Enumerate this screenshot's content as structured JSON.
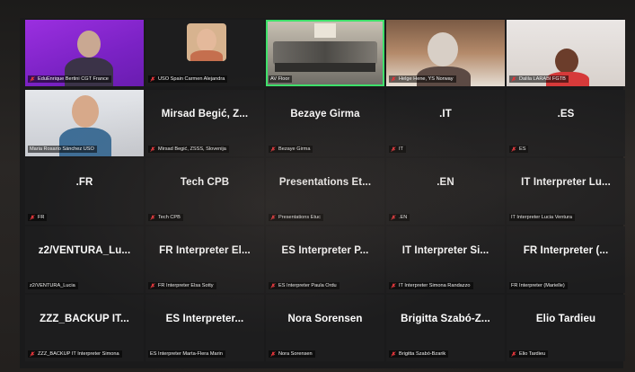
{
  "colors": {
    "background": "#1a1a1b",
    "active_speaker_border": "#3ee06a",
    "mic_muted": "#e0353a",
    "text": "#ffffff"
  },
  "participants": [
    {
      "label": "EduEnrique Bertini CGT France",
      "display_name": "",
      "video": true,
      "muted": true,
      "top_text": ""
    },
    {
      "label": "USO Spain Carmen Alejandra",
      "display_name": "",
      "video": true,
      "muted": true
    },
    {
      "label": "AV Floor",
      "display_name": "",
      "video": true,
      "muted": false,
      "active": true
    },
    {
      "label": "Helge Hene, YS Norway",
      "display_name": "",
      "video": true,
      "muted": true
    },
    {
      "label": "Dalila LARABI FGTB",
      "display_name": "",
      "video": true,
      "muted": true
    },
    {
      "label": "Maria Rosario Sánchez USO",
      "display_name": "",
      "video": true,
      "muted": false
    },
    {
      "label": "Mirsad Begić, ZSSS, Slovenija",
      "display_name": "Mirsad Begić, Z...",
      "video": false,
      "muted": true
    },
    {
      "label": "Bezaye Girma",
      "display_name": "Bezaye Girma",
      "video": false,
      "muted": true
    },
    {
      "label": "IT",
      "display_name": ".IT",
      "video": false,
      "muted": true
    },
    {
      "label": "ES",
      "display_name": ".ES",
      "video": false,
      "muted": true
    },
    {
      "label": "FR",
      "display_name": ".FR",
      "video": false,
      "muted": true
    },
    {
      "label": "Tech CPB",
      "display_name": "Tech CPB",
      "video": false,
      "muted": true
    },
    {
      "label": "Presentations Etuc",
      "display_name": "Presentations Et...",
      "video": false,
      "muted": true
    },
    {
      "label": ".EN",
      "display_name": ".EN",
      "video": false,
      "muted": true
    },
    {
      "label": "IT Interpreter Lucia Ventura",
      "display_name": "IT Interpreter Lu...",
      "video": false,
      "muted": false
    },
    {
      "label": "z2/VENTURA_Lucia",
      "display_name": "z2/VENTURA_Lu...",
      "video": false,
      "muted": false
    },
    {
      "label": "FR Interpreter Elsa Sotty",
      "display_name": "FR Interpreter El...",
      "video": false,
      "muted": true
    },
    {
      "label": "ES Interpreter Paula Ordu",
      "display_name": "ES Interpreter P...",
      "video": false,
      "muted": true
    },
    {
      "label": "IT Interpreter Simona Randazzo",
      "display_name": "IT Interpreter Si...",
      "video": false,
      "muted": true
    },
    {
      "label": "FR Interpreter (Marielle)",
      "display_name": "FR Interpreter (...",
      "video": false,
      "muted": false
    },
    {
      "label": "ZZZ_BACKUP IT Interpreter Simona",
      "display_name": "ZZZ_BACKUP IT...",
      "video": false,
      "muted": true
    },
    {
      "label": "ES Interpreter  Marta-Flera Marin",
      "display_name": "ES Interpreter...",
      "video": false,
      "muted": false
    },
    {
      "label": "Nora Sorensen",
      "display_name": "Nora Sorensen",
      "video": false,
      "muted": true
    },
    {
      "label": "Brigitta Szabó-Bzarik",
      "display_name": "Brigitta Szabó-Z...",
      "video": false,
      "muted": true
    },
    {
      "label": "Elio Tardieu",
      "display_name": "Elio Tardieu",
      "video": false,
      "muted": true
    }
  ]
}
